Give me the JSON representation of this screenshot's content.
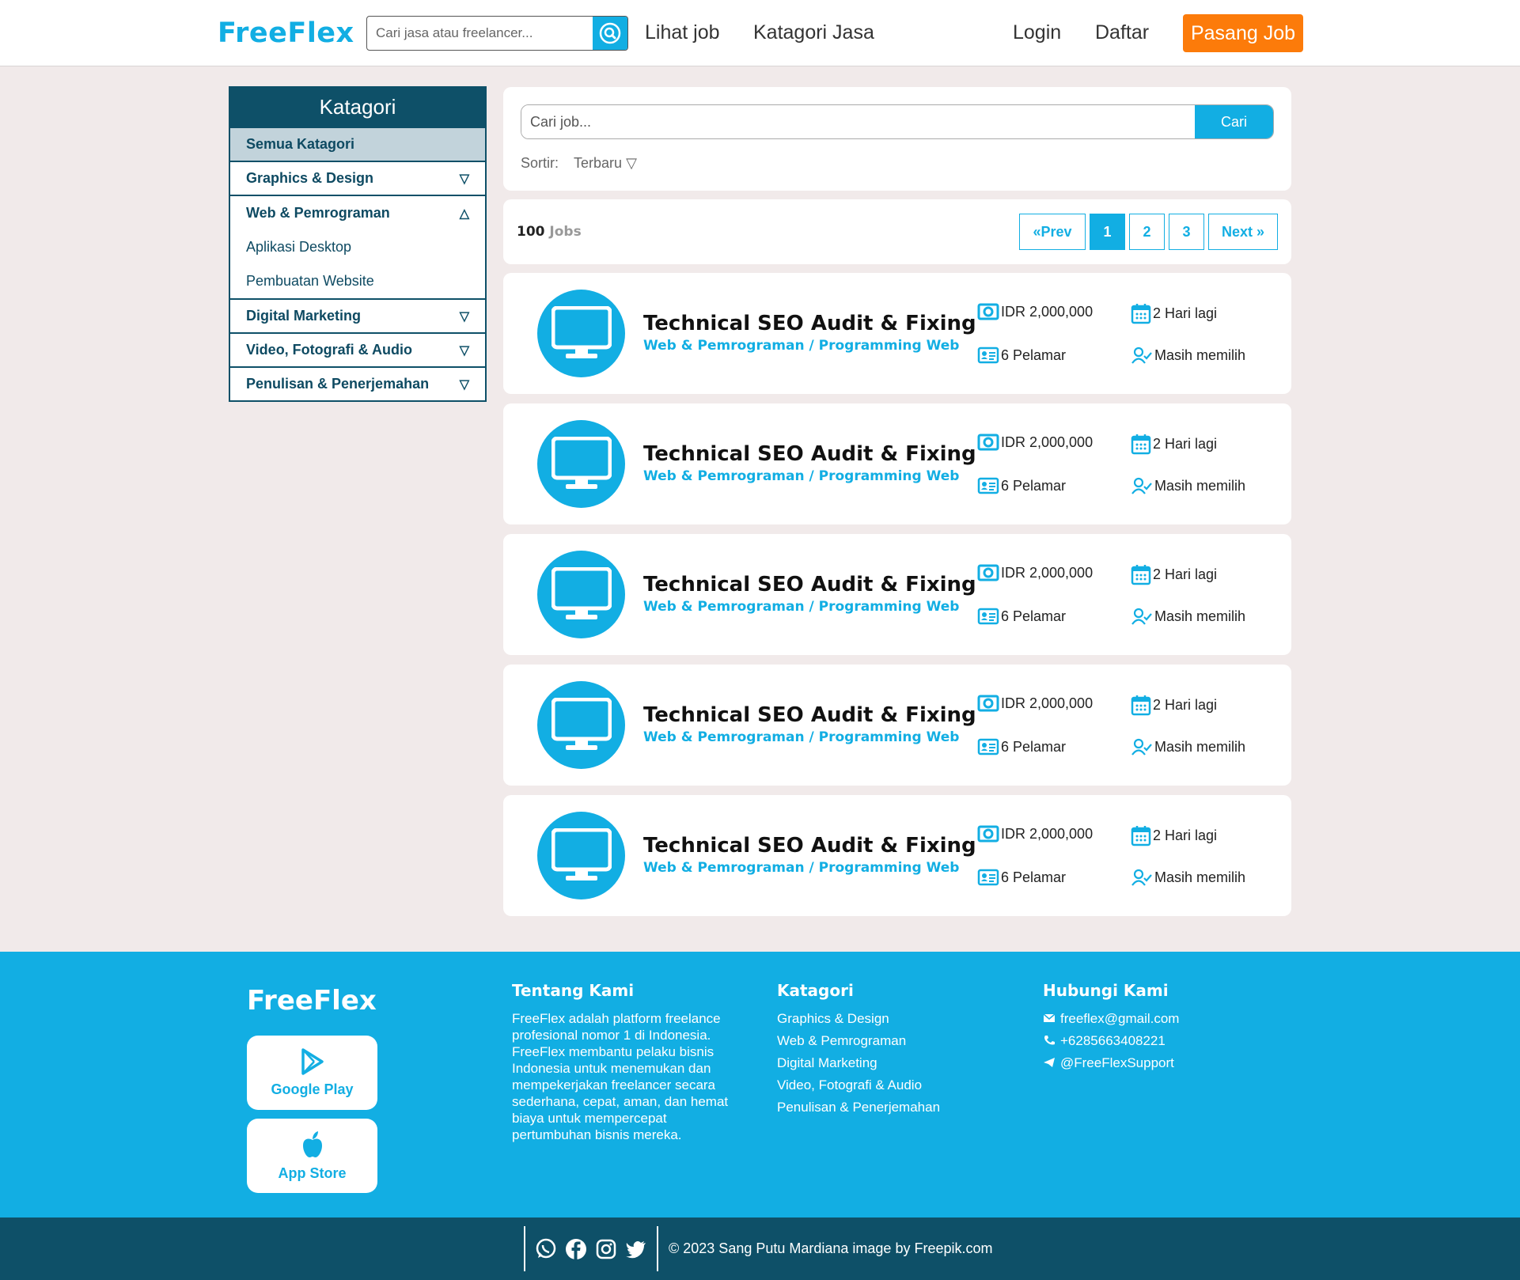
{
  "header": {
    "logo": "FreeFlex",
    "search_placeholder": "Cari jasa atau freelancer...",
    "nav": {
      "lihat_job": "Lihat job",
      "katagori_jasa": "Katagori Jasa",
      "login": "Login",
      "daftar": "Daftar"
    },
    "cta": "Pasang Job"
  },
  "sidebar": {
    "title": "Katagori",
    "all": "Semua Katagori",
    "items": [
      {
        "label": "Graphics & Design",
        "caret": "▽"
      },
      {
        "label": "Web & Pemrograman",
        "caret": "△"
      },
      {
        "label": "Digital Marketing",
        "caret": "▽"
      },
      {
        "label": "Video, Fotografi & Audio",
        "caret": "▽"
      },
      {
        "label": "Penulisan & Penerjemahan",
        "caret": "▽"
      }
    ],
    "subitems": [
      "Aplikasi Desktop",
      "Pembuatan Website"
    ]
  },
  "job_search": {
    "placeholder": "Cari job...",
    "button": "Cari",
    "sort_label": "Sortir:",
    "sort_value": "Terbaru ▽"
  },
  "results": {
    "count": "100",
    "count_label": "Jobs",
    "pagination": {
      "prev": "«Prev",
      "pages": [
        "1",
        "2",
        "3"
      ],
      "current": "1",
      "next": "Next »"
    }
  },
  "jobs": [
    {
      "title": "Technical SEO Audit & Fixing",
      "category": "Web & Pemrograman / Programming Web",
      "budget": "IDR 2,000,000",
      "deadline": "2 Hari lagi",
      "applicants": "6 Pelamar",
      "status": "Masih memilih"
    },
    {
      "title": "Technical SEO Audit & Fixing",
      "category": "Web & Pemrograman / Programming Web",
      "budget": "IDR 2,000,000",
      "deadline": "2 Hari lagi",
      "applicants": "6 Pelamar",
      "status": "Masih memilih"
    },
    {
      "title": "Technical SEO Audit & Fixing",
      "category": "Web & Pemrograman / Programming Web",
      "budget": "IDR 2,000,000",
      "deadline": "2 Hari lagi",
      "applicants": "6 Pelamar",
      "status": "Masih memilih"
    },
    {
      "title": "Technical SEO Audit & Fixing",
      "category": "Web & Pemrograman / Programming Web",
      "budget": "IDR 2,000,000",
      "deadline": "2 Hari lagi",
      "applicants": "6 Pelamar",
      "status": "Masih memilih"
    },
    {
      "title": "Technical SEO Audit & Fixing",
      "category": "Web & Pemrograman / Programming Web",
      "budget": "IDR 2,000,000",
      "deadline": "2 Hari lagi",
      "applicants": "6 Pelamar",
      "status": "Masih memilih"
    }
  ],
  "footer": {
    "logo": "FreeFlex",
    "google_play": "Google Play",
    "app_store": "App Store",
    "about_title": "Tentang Kami",
    "about_text": "FreeFlex adalah platform freelance profesional nomor 1 di Indonesia. FreeFlex membantu pelaku bisnis Indonesia untuk menemukan dan mempekerjakan freelancer secara sederhana, cepat, aman, dan hemat biaya untuk mempercepat pertumbuhan bisnis mereka.",
    "categories_title": "Katagori",
    "categories": [
      "Graphics & Design",
      "Web & Pemrograman",
      "Digital Marketing",
      "Video, Fotografi & Audio",
      "Penulisan & Penerjemahan"
    ],
    "contact_title": "Hubungi Kami",
    "contact": {
      "email": "freeflex@gmail.com",
      "phone": "+6285663408221",
      "telegram": "@FreeFlexSupport"
    },
    "copyright": "© 2023 Sang Putu Mardiana image by Freepik.com"
  },
  "colors": {
    "primary": "#12aee3",
    "dark": "#0e5068",
    "accent": "#fc7b0a",
    "background": "#f1eaea"
  },
  "icons": [
    "search-icon",
    "monitor-icon",
    "money-icon",
    "calendar-icon",
    "id-card-icon",
    "user-check-icon",
    "google-play-icon",
    "apple-icon",
    "mail-icon",
    "phone-icon",
    "telegram-icon",
    "whatsapp-icon",
    "facebook-icon",
    "instagram-icon",
    "twitter-icon"
  ]
}
